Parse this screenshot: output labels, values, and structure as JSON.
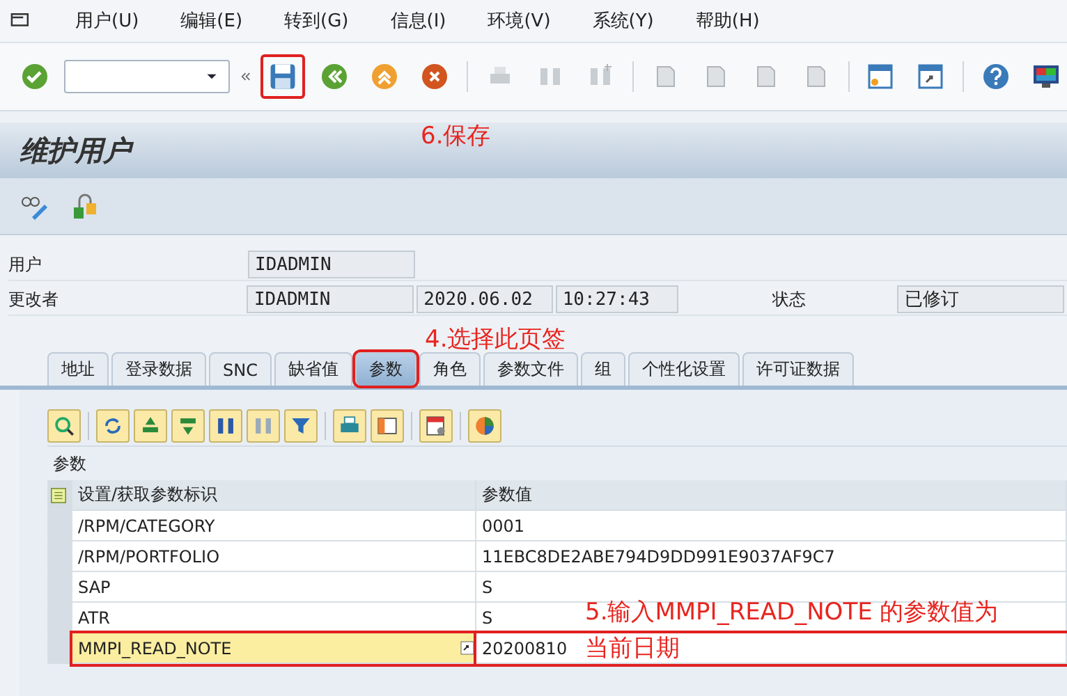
{
  "menu": [
    {
      "label": "用户(U)"
    },
    {
      "label": "编辑(E)"
    },
    {
      "label": "转到(G)"
    },
    {
      "label": "信息(I)"
    },
    {
      "label": "环境(V)"
    },
    {
      "label": "系统(Y)"
    },
    {
      "label": "帮助(H)"
    }
  ],
  "toolbar": {
    "save_button": {
      "highlighted": true
    }
  },
  "title": "维护用户",
  "header_fields": [
    {
      "label": "用户",
      "values": [
        "IDADMIN"
      ]
    },
    {
      "label": "更改者",
      "values": [
        "IDADMIN",
        "2020.06.02",
        "10:27:43"
      ]
    }
  ],
  "status": {
    "label": "状态",
    "value": "已修订"
  },
  "tabs": [
    {
      "label": "地址",
      "selected": false,
      "highlighted": false
    },
    {
      "label": "登录数据",
      "selected": false,
      "highlighted": false
    },
    {
      "label": "SNC",
      "selected": false,
      "highlighted": false
    },
    {
      "label": "缺省值",
      "selected": false,
      "highlighted": false
    },
    {
      "label": "参数",
      "selected": true,
      "highlighted": true
    },
    {
      "label": "角色",
      "selected": false,
      "highlighted": false
    },
    {
      "label": "参数文件",
      "selected": false,
      "highlighted": false
    },
    {
      "label": "组",
      "selected": false,
      "highlighted": false
    },
    {
      "label": "个性化设置",
      "selected": false,
      "highlighted": false
    },
    {
      "label": "许可证数据",
      "selected": false,
      "highlighted": false
    }
  ],
  "parameters": {
    "title": "参数",
    "columns": [
      "设置/获取参数标识",
      "参数值"
    ],
    "rows": [
      {
        "id": "/RPM/CATEGORY",
        "value": "0001",
        "editing": false,
        "highlighted": false
      },
      {
        "id": "/RPM/PORTFOLIO",
        "value": "11EBC8DE2ABE794D9DD991E9037AF9C7",
        "editing": false,
        "highlighted": false
      },
      {
        "id": "SAP",
        "value": "S",
        "editing": false,
        "highlighted": false
      },
      {
        "id": "ATR",
        "value": "S",
        "editing": false,
        "highlighted": false
      },
      {
        "id": "MMPI_READ_NOTE",
        "value": "20200810",
        "editing": true,
        "highlighted": true
      }
    ]
  },
  "annotations": [
    {
      "kind": "save",
      "text": "6.保存"
    },
    {
      "kind": "tab",
      "text": "4.选择此页签"
    },
    {
      "kind": "row",
      "text": "5.输入MMPI_READ_NOTE 的参数值为当前日期"
    }
  ]
}
